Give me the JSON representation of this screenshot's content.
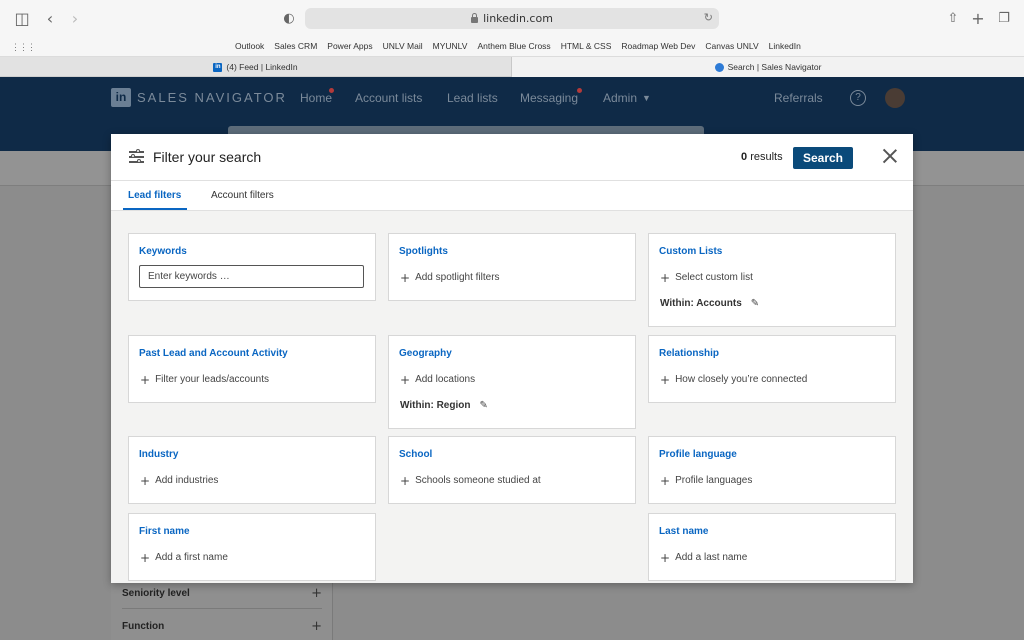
{
  "browser": {
    "url": "linkedin.com",
    "bookmarks": [
      "Outlook",
      "Sales CRM",
      "Power Apps",
      "UNLV Mail",
      "MYUNLV",
      "Anthem Blue Cross",
      "HTML & CSS",
      "Roadmap Web Dev",
      "Canvas UNLV",
      "LinkedIn"
    ],
    "tabs": [
      {
        "title": "(4) Feed | LinkedIn"
      },
      {
        "title": "Search | Sales Navigator"
      }
    ]
  },
  "app": {
    "logo_text": "SALES NAVIGATOR",
    "logo_mark": "in",
    "nav": [
      "Home",
      "Account lists",
      "Lead lists",
      "Messaging",
      "Admin"
    ],
    "referrals": "Referrals",
    "left_panel": [
      "Seniority level",
      "Function"
    ]
  },
  "modal": {
    "title": "Filter your search",
    "results_count": "0",
    "results_label": "results",
    "search_button": "Search",
    "tabs": [
      "Lead filters",
      "Account filters"
    ],
    "cards": {
      "keywords": {
        "title": "Keywords",
        "placeholder": "Enter keywords …"
      },
      "spotlights": {
        "title": "Spotlights",
        "action": "Add spotlight filters"
      },
      "custom_lists": {
        "title": "Custom Lists",
        "action": "Select custom list",
        "within": "Within: Accounts"
      },
      "past_activity": {
        "title": "Past Lead and Account Activity",
        "action": "Filter your leads/accounts"
      },
      "geography": {
        "title": "Geography",
        "action": "Add locations",
        "within": "Within: Region"
      },
      "relationship": {
        "title": "Relationship",
        "action": "How closely you’re connected"
      },
      "industry": {
        "title": "Industry",
        "action": "Add industries"
      },
      "school": {
        "title": "School",
        "action": "Schools someone studied at"
      },
      "profile_language": {
        "title": "Profile language",
        "action": "Profile languages"
      },
      "first_name": {
        "title": "First name",
        "action": "Add a first name"
      },
      "last_name": {
        "title": "Last name",
        "action": "Add a last name"
      }
    }
  }
}
